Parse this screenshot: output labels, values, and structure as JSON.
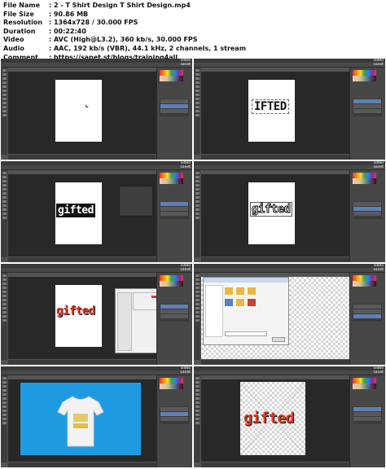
{
  "info": {
    "rows": [
      {
        "label": "File Name",
        "value": ":  2 - T Shirt Design T Shirt Design.mp4"
      },
      {
        "label": "File Size",
        "value": ":  90.86 MB"
      },
      {
        "label": "Resolution",
        "value": ":  1364x728 / 30.000 FPS"
      },
      {
        "label": "Duration",
        "value": ":  00:22:40"
      },
      {
        "label": "Video",
        "value": ":  AVC (High@L3.2), 360 kb/s, 30.000 FPS"
      },
      {
        "label": "Audio",
        "value": ":  AAC, 192 kb/s (VBR), 44.1 kHz, 2 channels, 1 stream"
      },
      {
        "label": "Comment",
        "value": ":  https://sanet.st/blogs/training4all"
      }
    ]
  },
  "thumbnails": [
    {
      "timestamp": "00:02:16",
      "artwork_text": ""
    },
    {
      "timestamp": "00:04:32",
      "artwork_text": "IFTED"
    },
    {
      "timestamp": "00:06:48",
      "artwork_text": "gifted"
    },
    {
      "timestamp": "00:09:04",
      "artwork_text": "gifted"
    },
    {
      "timestamp": "00:11:20",
      "artwork_text": "gifted"
    },
    {
      "timestamp": "00:13:36",
      "artwork_text": ""
    },
    {
      "timestamp": "00:15:52",
      "artwork_text": ""
    },
    {
      "timestamp": "00:18:08",
      "artwork_text": "gifted"
    }
  ],
  "watermark": "video\nsanet",
  "colors": {
    "ps_background": "#535353",
    "ps_canvas_bg": "#282828",
    "ps_panel": "#474747",
    "art_red": "#d63a2a",
    "photo_blue": "#1e9be0"
  }
}
